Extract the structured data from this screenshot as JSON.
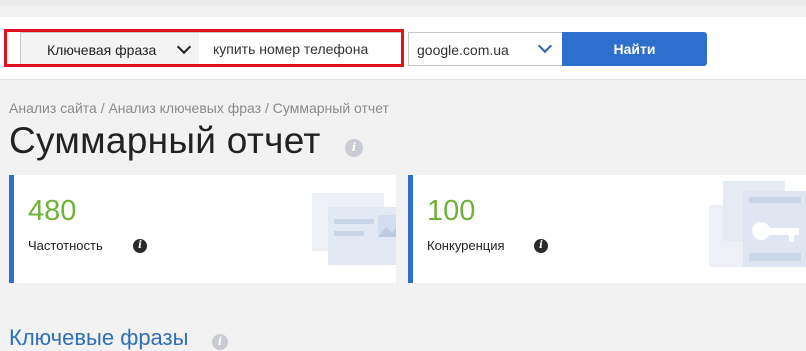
{
  "search": {
    "mode_label": "Ключевая фраза",
    "query_value": "купить номер телефона",
    "engine_label": "google.com.ua",
    "submit_label": "Найти"
  },
  "breadcrumb": "Анализ сайта / Анализ ключевых фраз / Суммарный отчет",
  "page_title": "Суммарный отчет",
  "cards": [
    {
      "value": "480",
      "label": "Частотность"
    },
    {
      "value": "100",
      "label": "Конкуренция"
    }
  ],
  "section_heading": "Ключевые фразы",
  "colors": {
    "accent": "#2d6fcc",
    "metric_value": "#6fb23b",
    "highlight_frame": "#e2121c"
  }
}
